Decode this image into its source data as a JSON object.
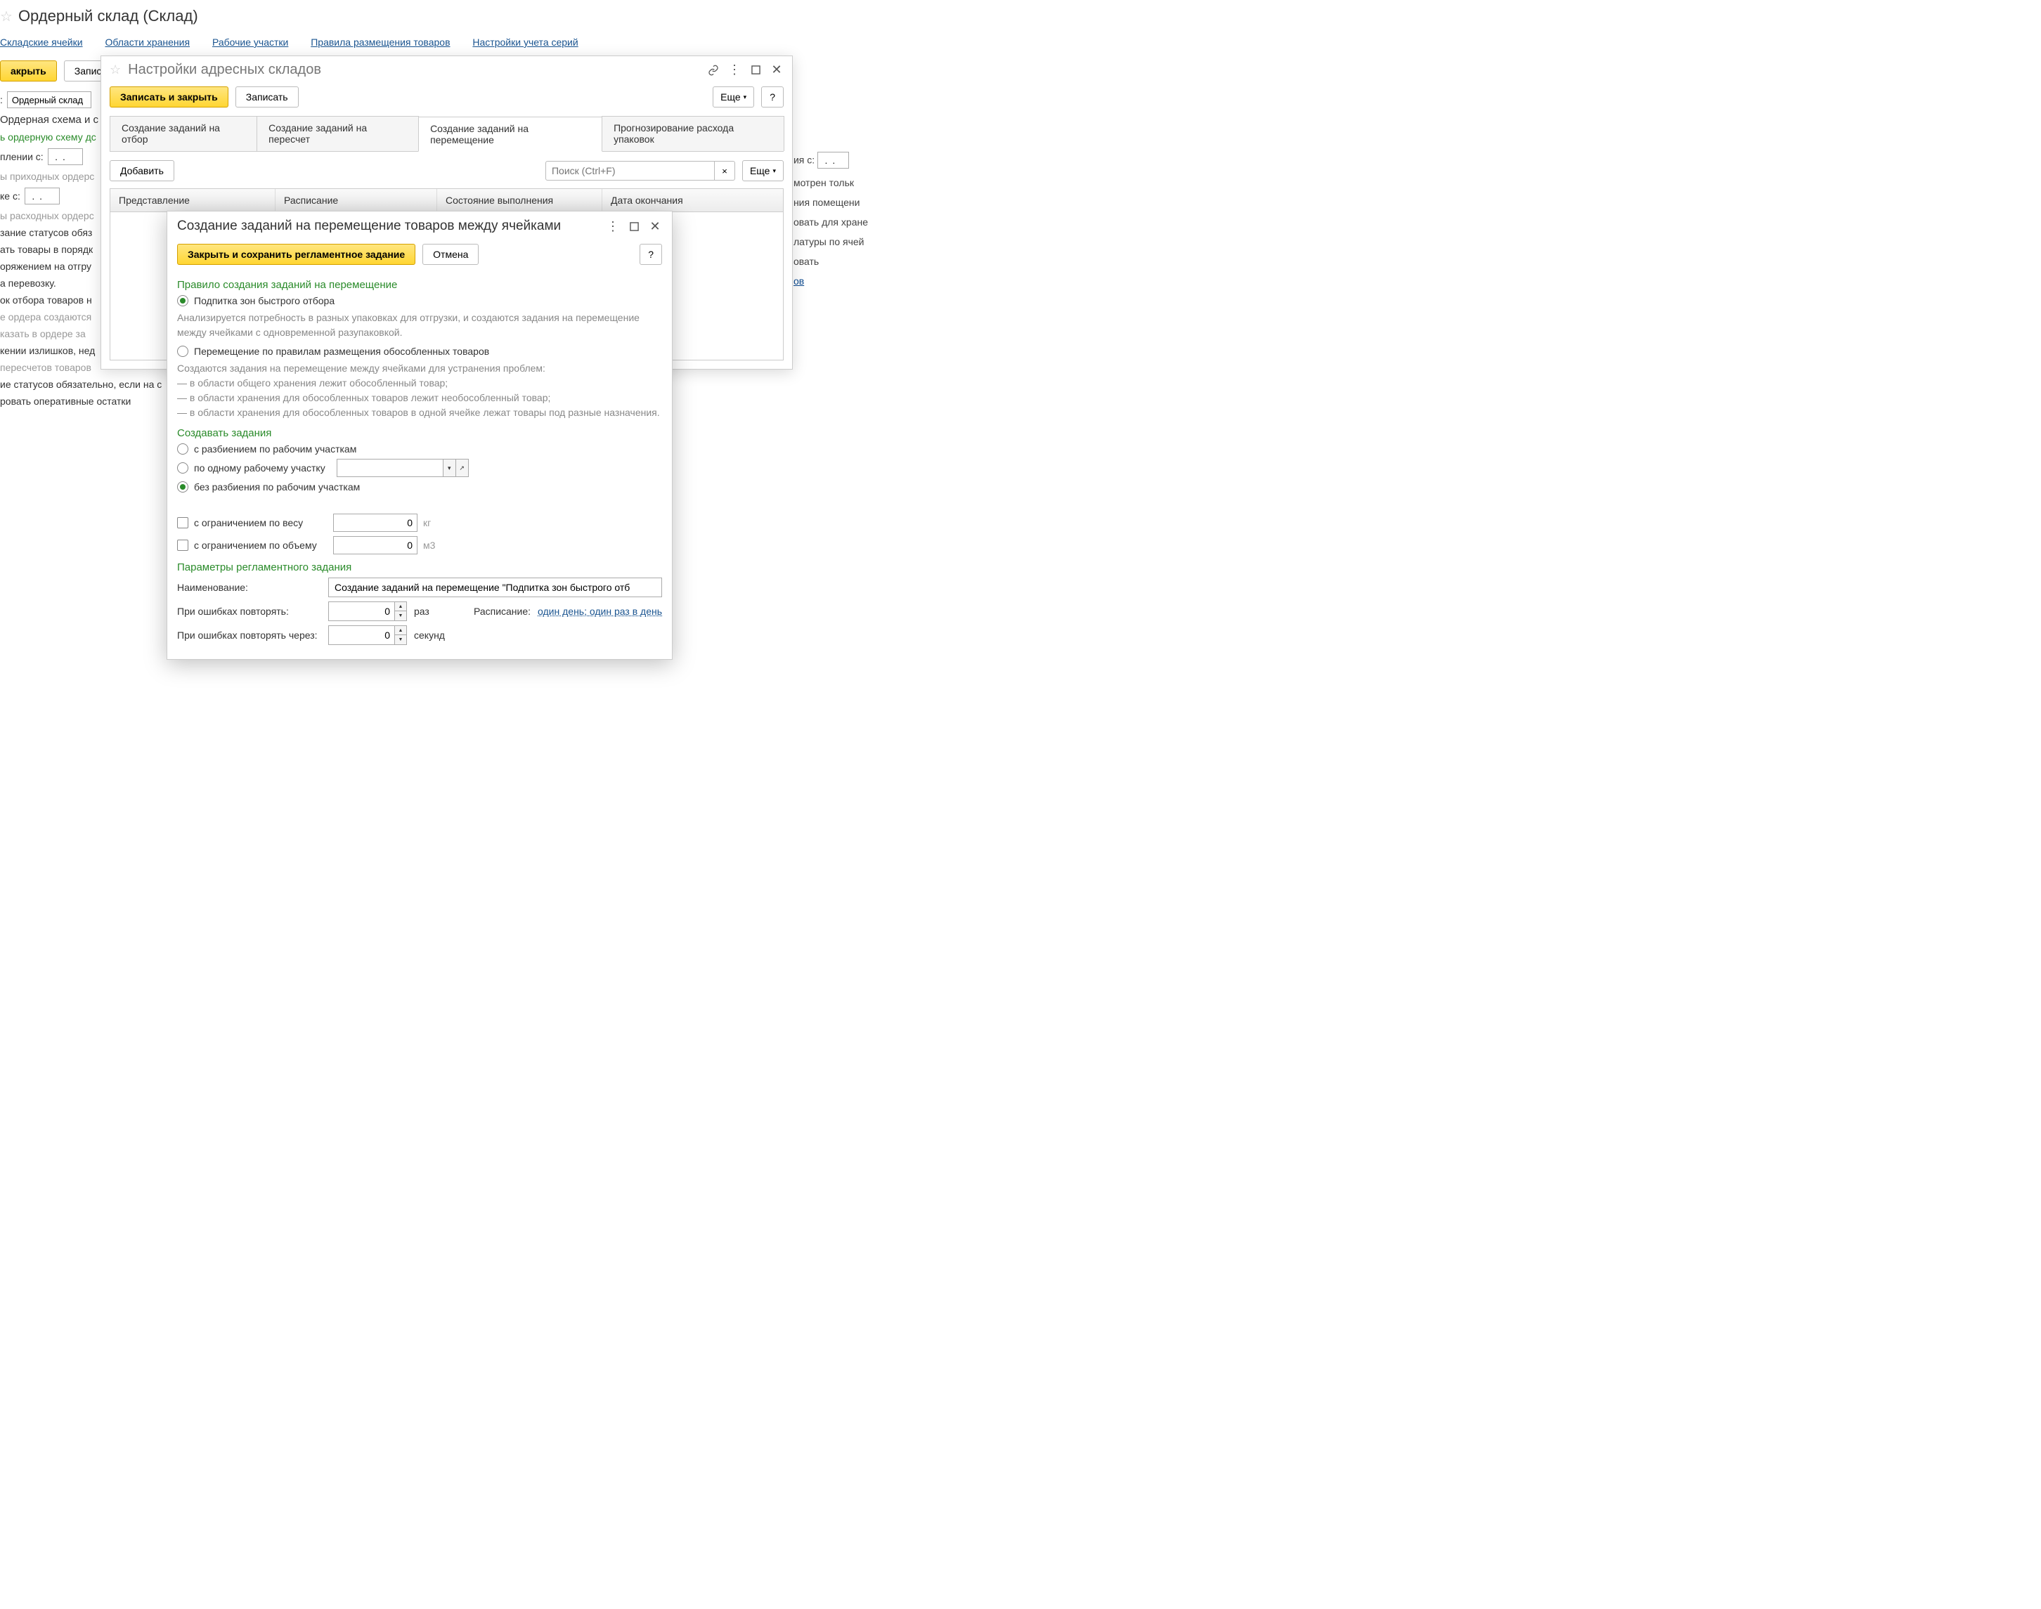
{
  "bg": {
    "title": "Ордерный склад (Склад)",
    "nav": [
      "Складские ячейки",
      "Области хранения",
      "Рабочие участки",
      "Правила размещения товаров",
      "Настройки учета серий"
    ],
    "close_btn": "акрыть",
    "write_btn": "Запис",
    "field1_value": "Ордерный склад",
    "heading1": "Ордерная схема и с",
    "green1": "ь ордерную схему дс",
    "label_c1": "плении  с:",
    "date1": " .  .",
    "text1": "ы приходных ордерс",
    "label_c2": "ке  с:",
    "date2": " .  .",
    "text2": "ы расходных ордерс",
    "text3": "зание статусов обяз",
    "text4": "ать товары в порядк",
    "text5": "оряжением на отгру",
    "text5b": "а перевозку.",
    "text6": "ок отбора товаров н",
    "text7": "е ордера создаются",
    "text8": "казать в ордере за",
    "text9": "кении излишков, нед",
    "text10": "пересчетов товаров",
    "text11": "ие статусов обязательно, если на с",
    "text12": "ровать оперативные остатки",
    "right_c": "ия  с:",
    "right_date": " .  .",
    "right1": "мотрен тольк",
    "right2": "ния помещени",
    "right3": "овать для хране",
    "right4": "латуры по ячей",
    "right5": "овать",
    "right6_link": "ов"
  },
  "mid": {
    "title": "Настройки адресных складов",
    "save_close": "Записать и закрыть",
    "write": "Записать",
    "more": "Еще",
    "help": "?",
    "tabs": [
      "Создание заданий на отбор",
      "Создание заданий на пересчет",
      "Создание заданий на перемещение",
      "Прогнозирование расхода упаковок"
    ],
    "add": "Добавить",
    "search_placeholder": "Поиск (Ctrl+F)",
    "cols": [
      "Представление",
      "Расписание",
      "Состояние выполнения",
      "Дата окончания"
    ]
  },
  "inner": {
    "title": "Создание заданий на перемещение товаров между ячейками",
    "save_close": "Закрыть и сохранить регламентное задание",
    "cancel": "Отмена",
    "help": "?",
    "section1": "Правило создания заданий на перемещение",
    "radio1": "Подпитка зон быстрого отбора",
    "desc1": "Анализируется потребность в разных упаковках для отгрузки, и создаются задания на перемещение между ячейками с одновременной разупаковкой.",
    "radio2": "Перемещение по правилам размещения обособленных товаров",
    "desc2a": "Создаются задания на перемещение между ячейками для устранения проблем:",
    "desc2b": "— в области общего хранения лежит обособленный товар;",
    "desc2c": "— в области хранения для обособленных товаров лежит необособленный товар;",
    "desc2d": "— в области хранения для обособленных товаров в одной ячейке лежат товары под разные назначения.",
    "section2": "Создавать задания",
    "radio3": "с разбиением по рабочим участкам",
    "radio4": "по одному рабочему участку",
    "radio5": "без разбиения по рабочим участкам",
    "check1": "с ограничением по весу",
    "weight_val": "0",
    "weight_unit": "кг",
    "check2": "с ограничением по объему",
    "vol_val": "0",
    "vol_unit": "м3",
    "section3": "Параметры регламентного задания",
    "name_label": "Наименование:",
    "name_value": "Создание заданий на перемещение \"Подпитка зон быстрого отб",
    "retry_label": "При ошибках повторять:",
    "retry_val": "0",
    "retry_unit": "раз",
    "sched_label": "Расписание:",
    "sched_link": "один день; один раз в день",
    "retry_after_label": "При ошибках повторять через:",
    "retry_after_val": "0",
    "retry_after_unit": "секунд"
  }
}
